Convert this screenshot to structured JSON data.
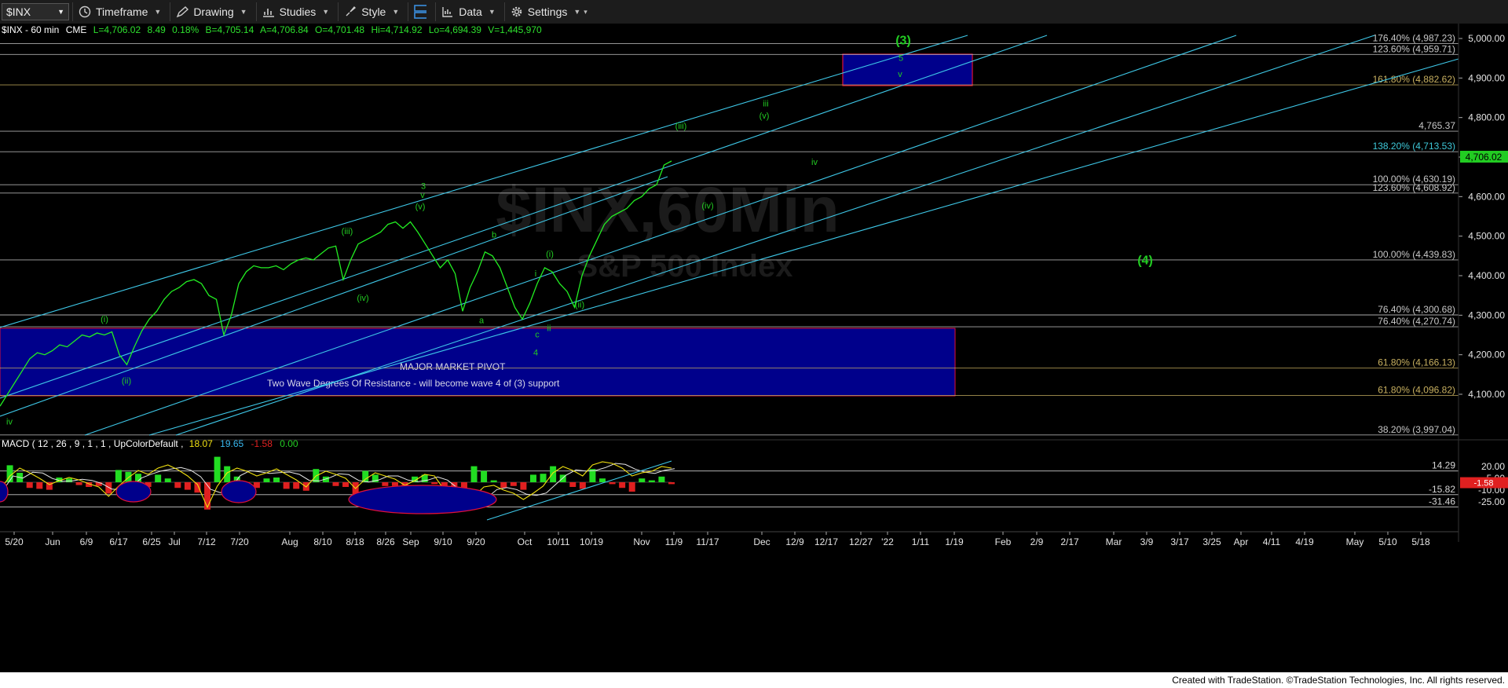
{
  "toolbar": {
    "symbol": "$INX",
    "items": [
      "Timeframe",
      "Drawing",
      "Studies",
      "Style",
      "Data",
      "Settings"
    ]
  },
  "header": {
    "symbol_info": "$INX - 60 min",
    "exchange": "CME",
    "last": "L=4,706.02",
    "change": "8.49",
    "change_pct": "0.18%",
    "bid": "B=4,705.14",
    "ask": "A=4,706.84",
    "open": "O=4,701.48",
    "high": "Hi=4,714.92",
    "low": "Lo=4,694.39",
    "volume": "V=1,445,970"
  },
  "watermark": {
    "line1": "$INX,60Min",
    "line2": "S&P 500 Index"
  },
  "colors": {
    "background": "#000000",
    "price": "#22ee22",
    "channel": "#3ec8e8",
    "zone": "#00008b",
    "zone_border": "#e0103a",
    "fib": "#c8c8c8",
    "gold_fib": "#c8b060",
    "wave_label": "#22cc22"
  },
  "zones": {
    "pivot_title": "MAJOR MARKET PIVOT",
    "pivot_note": "Two Wave Degrees Of Resistance - will become wave 4 of (3) support"
  },
  "macd": {
    "title": "MACD ( 12 , 26 , 9 , 1 , 1 , UpColorDefault ,",
    "macd_value": "18.07",
    "signal_value": "19.65",
    "hist_value": "-1.58",
    "zero_value": "0.00",
    "levels": [
      "14.29",
      "-15.82",
      "-31.46"
    ],
    "axis": [
      "20.00",
      "5.00",
      "-10.00",
      "-25.00"
    ],
    "hist_badge": "-1.58"
  },
  "footer": "Created with TradeStation. ©TradeStation Technologies, Inc. All rights reserved.",
  "chart_data": {
    "type": "line",
    "title": "$INX - 60 min",
    "ylim": [
      3940,
      5040
    ],
    "y_ticks": [
      "4,100.00",
      "4,200.00",
      "4,300.00",
      "4,400.00",
      "4,500.00",
      "4,600.00",
      "4,700.00",
      "4,800.00",
      "4,900.00",
      "5,000.00"
    ],
    "x_ticks": [
      "5/20",
      "Jun",
      "6/9",
      "6/17",
      "6/25",
      "Jul",
      "7/12",
      "7/20",
      "Aug",
      "8/10",
      "8/18",
      "8/26",
      "Sep",
      "9/10",
      "9/20",
      "Oct",
      "10/11",
      "10/19",
      "Nov",
      "11/9",
      "11/17",
      "Dec",
      "12/9",
      "12/17",
      "12/27",
      "'22",
      "1/11",
      "1/19",
      "Feb",
      "2/9",
      "2/17",
      "Mar",
      "3/9",
      "3/17",
      "3/25",
      "Apr",
      "4/11",
      "4/19",
      "May",
      "5/10",
      "5/18"
    ],
    "last_price": "4,706.02",
    "fib_levels": [
      {
        "label": "176.40% (4,987.23)",
        "value": 4987.23,
        "gold": false
      },
      {
        "label": "123.60% (4,959.71)",
        "value": 4959.71,
        "gold": false
      },
      {
        "label": "161.80% (4,882.62)",
        "value": 4882.62,
        "gold": true
      },
      {
        "label": "4,765.37",
        "value": 4765.37,
        "gold": false
      },
      {
        "label": "138.20% (4,713.53)",
        "value": 4713.53,
        "gold": false
      },
      {
        "label": "100.00% (4,630.19)",
        "value": 4630.19,
        "gold": false
      },
      {
        "label": "123.60% (4,608.92)",
        "value": 4608.92,
        "gold": false
      },
      {
        "label": "100.00% (4,439.83)",
        "value": 4439.83,
        "gold": false
      },
      {
        "label": "76.40% (4,300.68)",
        "value": 4300.68,
        "gold": false
      },
      {
        "label": "76.40% (4,270.74)",
        "value": 4270.74,
        "gold": false
      },
      {
        "label": "61.80% (4,166.13)",
        "value": 4166.13,
        "gold": true
      },
      {
        "label": "61.80% (4,096.82)",
        "value": 4096.82,
        "gold": true
      },
      {
        "label": "38.20% (3,997.04)",
        "value": 3997.04,
        "gold": false
      }
    ],
    "price_series": [
      [
        0,
        4070
      ],
      [
        0.5,
        4100
      ],
      [
        1,
        4130
      ],
      [
        1.5,
        4160
      ],
      [
        2,
        4190
      ],
      [
        2.5,
        4205
      ],
      [
        3,
        4200
      ],
      [
        3.5,
        4210
      ],
      [
        4,
        4225
      ],
      [
        4.5,
        4220
      ],
      [
        5,
        4235
      ],
      [
        5.5,
        4250
      ],
      [
        6,
        4245
      ],
      [
        6.5,
        4255
      ],
      [
        7,
        4250
      ],
      [
        7.5,
        4258
      ],
      [
        8,
        4200
      ],
      [
        8.5,
        4175
      ],
      [
        9,
        4220
      ],
      [
        9.5,
        4260
      ],
      [
        10,
        4290
      ],
      [
        10.5,
        4310
      ],
      [
        11,
        4340
      ],
      [
        11.5,
        4360
      ],
      [
        12,
        4370
      ],
      [
        12.5,
        4385
      ],
      [
        13,
        4390
      ],
      [
        13.5,
        4380
      ],
      [
        14,
        4350
      ],
      [
        14.5,
        4340
      ],
      [
        15,
        4250
      ],
      [
        15.5,
        4300
      ],
      [
        16,
        4380
      ],
      [
        16.5,
        4410
      ],
      [
        17,
        4425
      ],
      [
        17.5,
        4420
      ],
      [
        18,
        4420
      ],
      [
        18.5,
        4425
      ],
      [
        19,
        4415
      ],
      [
        19.5,
        4430
      ],
      [
        20,
        4440
      ],
      [
        20.5,
        4445
      ],
      [
        21,
        4440
      ],
      [
        21.5,
        4455
      ],
      [
        22,
        4470
      ],
      [
        22.5,
        4475
      ],
      [
        23,
        4390
      ],
      [
        23.5,
        4440
      ],
      [
        24,
        4480
      ],
      [
        24.5,
        4490
      ],
      [
        25,
        4500
      ],
      [
        25.5,
        4510
      ],
      [
        26,
        4530
      ],
      [
        26.5,
        4536
      ],
      [
        27,
        4520
      ],
      [
        27.5,
        4536
      ],
      [
        28,
        4510
      ],
      [
        28.5,
        4480
      ],
      [
        29,
        4450
      ],
      [
        29.5,
        4420
      ],
      [
        30,
        4440
      ],
      [
        30.5,
        4405
      ],
      [
        31,
        4310
      ],
      [
        31.5,
        4370
      ],
      [
        32,
        4410
      ],
      [
        32.5,
        4460
      ],
      [
        33,
        4450
      ],
      [
        33.5,
        4420
      ],
      [
        34,
        4370
      ],
      [
        34.5,
        4320
      ],
      [
        35,
        4290
      ],
      [
        35.5,
        4330
      ],
      [
        36,
        4380
      ],
      [
        36.5,
        4420
      ],
      [
        37,
        4410
      ],
      [
        37.5,
        4380
      ],
      [
        38,
        4360
      ],
      [
        38.5,
        4320
      ],
      [
        39,
        4400
      ],
      [
        39.5,
        4450
      ],
      [
        40,
        4490
      ],
      [
        40.5,
        4530
      ],
      [
        41,
        4550
      ],
      [
        41.5,
        4560
      ],
      [
        42,
        4570
      ],
      [
        42.5,
        4590
      ],
      [
        43,
        4600
      ],
      [
        43.5,
        4620
      ],
      [
        44,
        4630
      ],
      [
        44.5,
        4680
      ],
      [
        45,
        4690
      ]
    ],
    "wave_labels": [
      {
        "t": "(3)",
        "x": 1150,
        "y": 4985,
        "big": true
      },
      {
        "t": "5",
        "x": 1147,
        "y": 4943
      },
      {
        "t": "v",
        "x": 1146,
        "y": 4903
      },
      {
        "t": "iii",
        "x": 975,
        "y": 4828
      },
      {
        "t": "(v)",
        "x": 973,
        "y": 4797
      },
      {
        "t": "(iii)",
        "x": 867,
        "y": 4772
      },
      {
        "t": "iv",
        "x": 1037,
        "y": 4680
      },
      {
        "t": "(iv)",
        "x": 901,
        "y": 4570
      },
      {
        "t": "3",
        "x": 539,
        "y": 4620
      },
      {
        "t": "v",
        "x": 538,
        "y": 4597
      },
      {
        "t": "(v)",
        "x": 535,
        "y": 4568
      },
      {
        "t": "(iii)",
        "x": 442,
        "y": 4505
      },
      {
        "t": "b",
        "x": 629,
        "y": 4496
      },
      {
        "t": "(i)",
        "x": 700,
        "y": 4448
      },
      {
        "t": "i",
        "x": 682,
        "y": 4398
      },
      {
        "t": "(iv)",
        "x": 462,
        "y": 4336
      },
      {
        "t": "(ii)",
        "x": 738,
        "y": 4320
      },
      {
        "t": "a",
        "x": 613,
        "y": 4280
      },
      {
        "t": "ii",
        "x": 699,
        "y": 4260
      },
      {
        "t": "c",
        "x": 684,
        "y": 4244
      },
      {
        "t": "4",
        "x": 682,
        "y": 4198
      },
      {
        "t": "(i)",
        "x": 133,
        "y": 4283
      },
      {
        "t": "(ii)",
        "x": 161,
        "y": 4127
      },
      {
        "t": "iv",
        "x": 12,
        "y": 4024
      },
      {
        "t": "(4)",
        "x": 1458,
        "y": 4429,
        "big": true
      }
    ],
    "macd_series": [
      [
        0,
        -10
      ],
      [
        0.5,
        8
      ],
      [
        1,
        18
      ],
      [
        1.5,
        12
      ],
      [
        2,
        5
      ],
      [
        2.5,
        -3
      ],
      [
        3,
        2
      ],
      [
        3.5,
        6
      ],
      [
        4,
        3
      ],
      [
        4.5,
        -2
      ],
      [
        5,
        -6
      ],
      [
        5.5,
        -18
      ],
      [
        6,
        -5
      ],
      [
        6.5,
        6
      ],
      [
        7,
        15
      ],
      [
        7.5,
        10
      ],
      [
        8,
        18
      ],
      [
        8.5,
        22
      ],
      [
        9,
        16
      ],
      [
        9.5,
        8
      ],
      [
        10,
        -3
      ],
      [
        10.5,
        -32
      ],
      [
        11,
        -5
      ],
      [
        11.5,
        12
      ],
      [
        12,
        18
      ],
      [
        12.5,
        14
      ],
      [
        13,
        8
      ],
      [
        13.5,
        12
      ],
      [
        14,
        17
      ],
      [
        14.5,
        10
      ],
      [
        15,
        3
      ],
      [
        15.5,
        -6
      ],
      [
        16,
        8
      ],
      [
        16.5,
        14
      ],
      [
        17,
        10
      ],
      [
        17.5,
        5
      ],
      [
        18,
        -8
      ],
      [
        18.5,
        4
      ],
      [
        19,
        12
      ],
      [
        19.5,
        8
      ],
      [
        20,
        4
      ],
      [
        20.5,
        -4
      ],
      [
        21,
        2
      ],
      [
        21.5,
        10
      ],
      [
        22,
        8
      ],
      [
        22.5,
        -10
      ],
      [
        23,
        -20
      ],
      [
        23.5,
        -35
      ],
      [
        24,
        -18
      ],
      [
        24.5,
        -6
      ],
      [
        25,
        -4
      ],
      [
        25.5,
        -10
      ],
      [
        26,
        -14
      ],
      [
        26.5,
        -22
      ],
      [
        27,
        -14
      ],
      [
        27.5,
        -5
      ],
      [
        28,
        12
      ],
      [
        28.5,
        20
      ],
      [
        29,
        15
      ],
      [
        29.5,
        8
      ],
      [
        30,
        22
      ],
      [
        30.5,
        26
      ],
      [
        31,
        24
      ],
      [
        31.5,
        18
      ],
      [
        32,
        8
      ],
      [
        32.5,
        12
      ],
      [
        33,
        14
      ],
      [
        33.5,
        20
      ],
      [
        34,
        18
      ]
    ]
  }
}
